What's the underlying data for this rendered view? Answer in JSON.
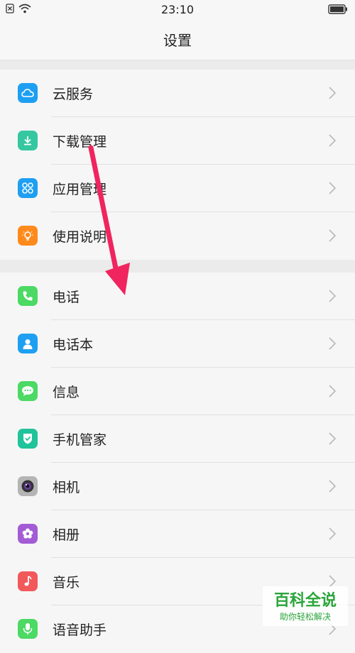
{
  "status": {
    "time": "23:10"
  },
  "header": {
    "title": "设置"
  },
  "groups": [
    {
      "items": [
        {
          "label": "云服务",
          "icon": "cloud-icon",
          "color": "#1e9ff2"
        },
        {
          "label": "下载管理",
          "icon": "download-icon",
          "color": "#34c7a0"
        },
        {
          "label": "应用管理",
          "icon": "apps-icon",
          "color": "#1e9ff2"
        },
        {
          "label": "使用说明",
          "icon": "bulb-icon",
          "color": "#ff8a1c"
        }
      ]
    },
    {
      "items": [
        {
          "label": "电话",
          "icon": "phone-icon",
          "color": "#4cd964"
        },
        {
          "label": "电话本",
          "icon": "contacts-icon",
          "color": "#1e9ff2"
        },
        {
          "label": "信息",
          "icon": "message-icon",
          "color": "#4cd964"
        },
        {
          "label": "手机管家",
          "icon": "shield-icon",
          "color": "#20c39a"
        },
        {
          "label": "相机",
          "icon": "camera-icon",
          "color": "#9a9a9a"
        },
        {
          "label": "相册",
          "icon": "flower-icon",
          "color": "#a35bd6"
        },
        {
          "label": "音乐",
          "icon": "music-icon",
          "color": "#f2595b"
        },
        {
          "label": "语音助手",
          "icon": "mic-icon",
          "color": "#4cd964"
        }
      ]
    }
  ],
  "watermark": {
    "title": "百科全说",
    "subtitle": "助你轻松解决"
  },
  "annotation": {
    "arrow_color": "#f0245e"
  }
}
